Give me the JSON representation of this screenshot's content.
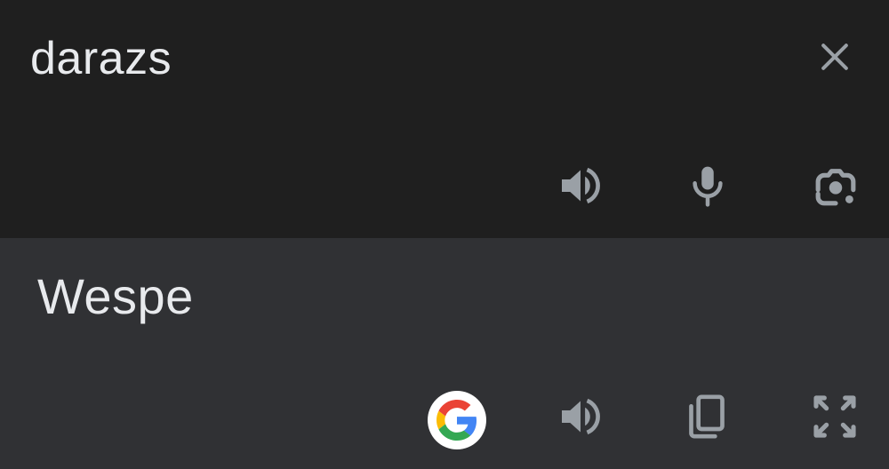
{
  "source": {
    "text": "darazs",
    "actions": {
      "clear": "close-icon",
      "listen": "speaker-icon",
      "voice": "microphone-icon",
      "camera": "google-lens-icon"
    }
  },
  "target": {
    "text": "Wespe",
    "actions": {
      "search": "google-g-icon",
      "listen": "speaker-icon",
      "copy": "copy-icon",
      "fullscreen": "fullscreen-icon"
    }
  },
  "colors": {
    "source_background": "#1f1f1f",
    "target_background": "#303134",
    "text": "#e8eaed",
    "icon": "#9aa0a6",
    "google_blue": "#4285f4",
    "google_red": "#ea4335",
    "google_yellow": "#fbbc05",
    "google_green": "#34a853"
  }
}
